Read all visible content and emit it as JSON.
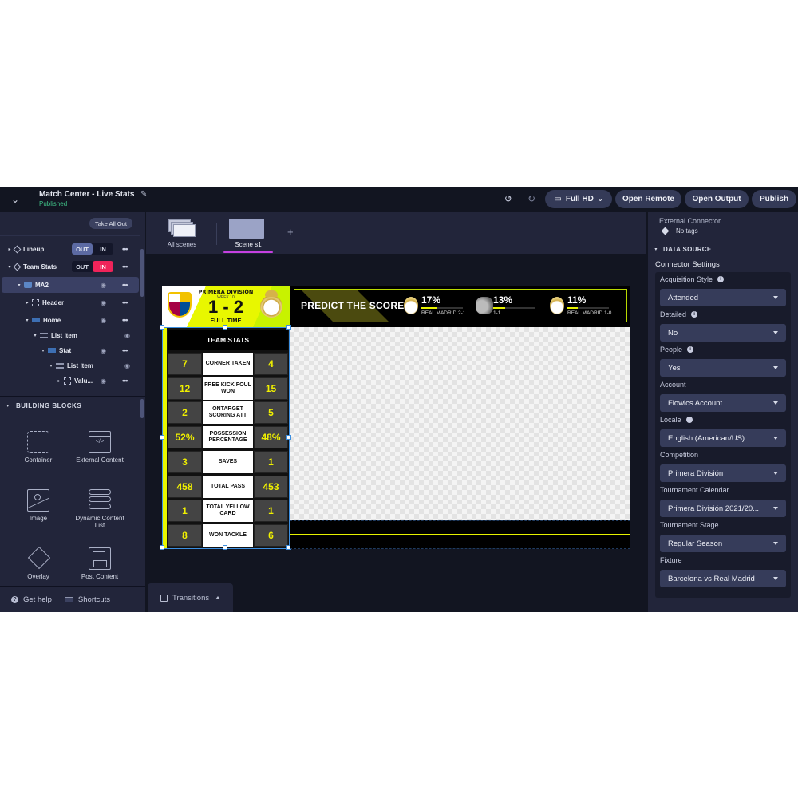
{
  "header": {
    "title": "Match Center - Live Stats",
    "status": "Published",
    "display_mode": "Full HD",
    "buttons": {
      "open_remote": "Open Remote",
      "open_output": "Open Output",
      "publish": "Publish"
    }
  },
  "left_panel": {
    "take_all_out": "Take All Out",
    "layers": [
      {
        "label": "Lineup",
        "out": "OUT",
        "in": "IN",
        "state": "OUT"
      },
      {
        "label": "Team Stats",
        "out": "OUT",
        "in": "IN",
        "state": "IN"
      }
    ],
    "tree": [
      {
        "label": "MA2",
        "selected": true
      },
      {
        "label": "Header"
      },
      {
        "label": "Home"
      },
      {
        "label": "List Item"
      },
      {
        "label": "Stat"
      },
      {
        "label": "List Item"
      },
      {
        "label": "Valu..."
      }
    ],
    "building_blocks": {
      "title": "BUILDING BLOCKS",
      "items": [
        "Container",
        "External Content",
        "Image",
        "Dynamic Content List",
        "Overlay",
        "Post Content"
      ]
    },
    "help": "Get help",
    "shortcuts": "Shortcuts"
  },
  "scenes": {
    "all_scenes": "All scenes",
    "active_scene": "Scene s1",
    "add": "+"
  },
  "graphic": {
    "scoreboard": {
      "league": "PRIMERA DIVISIÓN",
      "week": "WEEK 10",
      "score": "1 - 2",
      "status": "FULL TIME",
      "home_team": "FC Barcelona",
      "away_team": "Real Madrid"
    },
    "predict": {
      "title": "PREDICT THE SCORE",
      "options": [
        {
          "pct": "17%",
          "fraction": 0.17,
          "label": "REAL MADRID 2-1",
          "crest": "real-madrid"
        },
        {
          "pct": "13%",
          "fraction": 0.13,
          "label": "1-1",
          "crest": "draw"
        },
        {
          "pct": "11%",
          "fraction": 0.11,
          "label": "REAL MADRID 1-0",
          "crest": "real-madrid"
        }
      ]
    },
    "team_stats": {
      "title": "TEAM STATS",
      "rows": [
        {
          "home": "7",
          "name": "CORNER TAKEN",
          "away": "4"
        },
        {
          "home": "12",
          "name": "FREE KICK FOUL WON",
          "away": "15"
        },
        {
          "home": "2",
          "name": "ONTARGET SCORING ATT",
          "away": "5"
        },
        {
          "home": "52%",
          "name": "POSSESSION PERCENTAGE",
          "away": "48%"
        },
        {
          "home": "3",
          "name": "SAVES",
          "away": "1"
        },
        {
          "home": "458",
          "name": "TOTAL PASS",
          "away": "453"
        },
        {
          "home": "1",
          "name": "TOTAL YELLOW CARD",
          "away": "1"
        },
        {
          "home": "8",
          "name": "WON TACKLE",
          "away": "6"
        }
      ]
    }
  },
  "right_panel": {
    "component": "External Connector",
    "tags": "No tags",
    "section": "DATA SOURCE",
    "connector_settings": "Connector Settings",
    "fields": [
      {
        "label": "Acquisition Style",
        "info": true,
        "value": "Attended"
      },
      {
        "label": "Detailed",
        "info": true,
        "value": "No"
      },
      {
        "label": "People",
        "info": true,
        "value": "Yes"
      },
      {
        "label": "Account",
        "info": false,
        "value": "Flowics Account"
      },
      {
        "label": "Locale",
        "info": true,
        "value": "English (American/US)"
      },
      {
        "label": "Competition",
        "info": false,
        "value": "Primera División"
      },
      {
        "label": "Tournament Calendar",
        "info": false,
        "value": "Primera División 2021/20..."
      },
      {
        "label": "Tournament Stage",
        "info": false,
        "value": "Regular Season"
      },
      {
        "label": "Fixture",
        "info": false,
        "value": "Barcelona vs Real Madrid"
      }
    ]
  },
  "bottom": {
    "transitions": "Transitions"
  },
  "colors": {
    "accent_in": "#f0245a",
    "accent_scene": "#c640e0",
    "published": "#3fbf86",
    "graphic_yellow": "#e8f700"
  }
}
